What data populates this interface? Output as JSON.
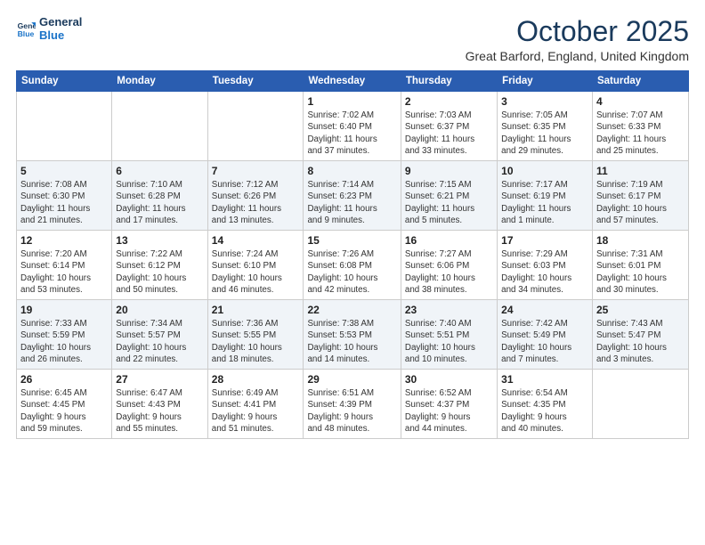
{
  "logo": {
    "line1": "General",
    "line2": "Blue"
  },
  "title": "October 2025",
  "location": "Great Barford, England, United Kingdom",
  "weekdays": [
    "Sunday",
    "Monday",
    "Tuesday",
    "Wednesday",
    "Thursday",
    "Friday",
    "Saturday"
  ],
  "weeks": [
    [
      {
        "day": "",
        "info": ""
      },
      {
        "day": "",
        "info": ""
      },
      {
        "day": "",
        "info": ""
      },
      {
        "day": "1",
        "info": "Sunrise: 7:02 AM\nSunset: 6:40 PM\nDaylight: 11 hours\nand 37 minutes."
      },
      {
        "day": "2",
        "info": "Sunrise: 7:03 AM\nSunset: 6:37 PM\nDaylight: 11 hours\nand 33 minutes."
      },
      {
        "day": "3",
        "info": "Sunrise: 7:05 AM\nSunset: 6:35 PM\nDaylight: 11 hours\nand 29 minutes."
      },
      {
        "day": "4",
        "info": "Sunrise: 7:07 AM\nSunset: 6:33 PM\nDaylight: 11 hours\nand 25 minutes."
      }
    ],
    [
      {
        "day": "5",
        "info": "Sunrise: 7:08 AM\nSunset: 6:30 PM\nDaylight: 11 hours\nand 21 minutes."
      },
      {
        "day": "6",
        "info": "Sunrise: 7:10 AM\nSunset: 6:28 PM\nDaylight: 11 hours\nand 17 minutes."
      },
      {
        "day": "7",
        "info": "Sunrise: 7:12 AM\nSunset: 6:26 PM\nDaylight: 11 hours\nand 13 minutes."
      },
      {
        "day": "8",
        "info": "Sunrise: 7:14 AM\nSunset: 6:23 PM\nDaylight: 11 hours\nand 9 minutes."
      },
      {
        "day": "9",
        "info": "Sunrise: 7:15 AM\nSunset: 6:21 PM\nDaylight: 11 hours\nand 5 minutes."
      },
      {
        "day": "10",
        "info": "Sunrise: 7:17 AM\nSunset: 6:19 PM\nDaylight: 11 hours\nand 1 minute."
      },
      {
        "day": "11",
        "info": "Sunrise: 7:19 AM\nSunset: 6:17 PM\nDaylight: 10 hours\nand 57 minutes."
      }
    ],
    [
      {
        "day": "12",
        "info": "Sunrise: 7:20 AM\nSunset: 6:14 PM\nDaylight: 10 hours\nand 53 minutes."
      },
      {
        "day": "13",
        "info": "Sunrise: 7:22 AM\nSunset: 6:12 PM\nDaylight: 10 hours\nand 50 minutes."
      },
      {
        "day": "14",
        "info": "Sunrise: 7:24 AM\nSunset: 6:10 PM\nDaylight: 10 hours\nand 46 minutes."
      },
      {
        "day": "15",
        "info": "Sunrise: 7:26 AM\nSunset: 6:08 PM\nDaylight: 10 hours\nand 42 minutes."
      },
      {
        "day": "16",
        "info": "Sunrise: 7:27 AM\nSunset: 6:06 PM\nDaylight: 10 hours\nand 38 minutes."
      },
      {
        "day": "17",
        "info": "Sunrise: 7:29 AM\nSunset: 6:03 PM\nDaylight: 10 hours\nand 34 minutes."
      },
      {
        "day": "18",
        "info": "Sunrise: 7:31 AM\nSunset: 6:01 PM\nDaylight: 10 hours\nand 30 minutes."
      }
    ],
    [
      {
        "day": "19",
        "info": "Sunrise: 7:33 AM\nSunset: 5:59 PM\nDaylight: 10 hours\nand 26 minutes."
      },
      {
        "day": "20",
        "info": "Sunrise: 7:34 AM\nSunset: 5:57 PM\nDaylight: 10 hours\nand 22 minutes."
      },
      {
        "day": "21",
        "info": "Sunrise: 7:36 AM\nSunset: 5:55 PM\nDaylight: 10 hours\nand 18 minutes."
      },
      {
        "day": "22",
        "info": "Sunrise: 7:38 AM\nSunset: 5:53 PM\nDaylight: 10 hours\nand 14 minutes."
      },
      {
        "day": "23",
        "info": "Sunrise: 7:40 AM\nSunset: 5:51 PM\nDaylight: 10 hours\nand 10 minutes."
      },
      {
        "day": "24",
        "info": "Sunrise: 7:42 AM\nSunset: 5:49 PM\nDaylight: 10 hours\nand 7 minutes."
      },
      {
        "day": "25",
        "info": "Sunrise: 7:43 AM\nSunset: 5:47 PM\nDaylight: 10 hours\nand 3 minutes."
      }
    ],
    [
      {
        "day": "26",
        "info": "Sunrise: 6:45 AM\nSunset: 4:45 PM\nDaylight: 9 hours\nand 59 minutes."
      },
      {
        "day": "27",
        "info": "Sunrise: 6:47 AM\nSunset: 4:43 PM\nDaylight: 9 hours\nand 55 minutes."
      },
      {
        "day": "28",
        "info": "Sunrise: 6:49 AM\nSunset: 4:41 PM\nDaylight: 9 hours\nand 51 minutes."
      },
      {
        "day": "29",
        "info": "Sunrise: 6:51 AM\nSunset: 4:39 PM\nDaylight: 9 hours\nand 48 minutes."
      },
      {
        "day": "30",
        "info": "Sunrise: 6:52 AM\nSunset: 4:37 PM\nDaylight: 9 hours\nand 44 minutes."
      },
      {
        "day": "31",
        "info": "Sunrise: 6:54 AM\nSunset: 4:35 PM\nDaylight: 9 hours\nand 40 minutes."
      },
      {
        "day": "",
        "info": ""
      }
    ]
  ]
}
